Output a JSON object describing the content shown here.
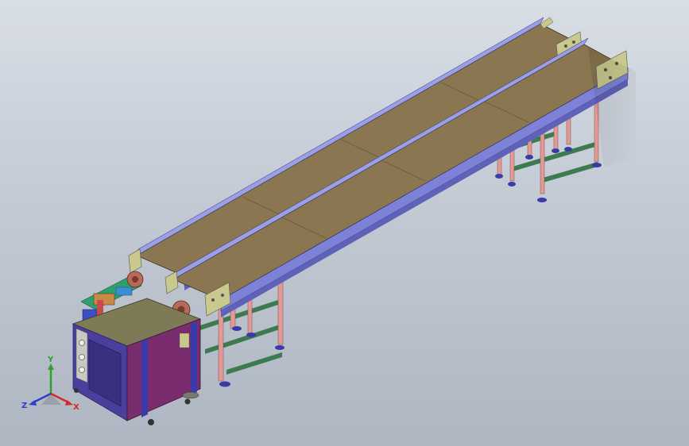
{
  "viewport": {
    "background_top": "#d9dee6",
    "background_bottom": "#aeb6c2"
  },
  "model": {
    "conveyor_count": 2,
    "belt_color": "#8a7650",
    "frame_color": "#7d82d6",
    "leg_color": "#e29a96",
    "brace_color": "#3c7a50",
    "foot_color": "#3a3aa8",
    "bracket_color": "#c9c98e",
    "cabinet_panel_color": "#4a3f9c",
    "cabinet_side_color": "#7a2d6e"
  },
  "triad": {
    "y_label": "Y",
    "z_label": "Z",
    "x_label": "X",
    "y_color": "#2ea02e",
    "x_color": "#d62828",
    "z_color": "#2b3fc9"
  }
}
